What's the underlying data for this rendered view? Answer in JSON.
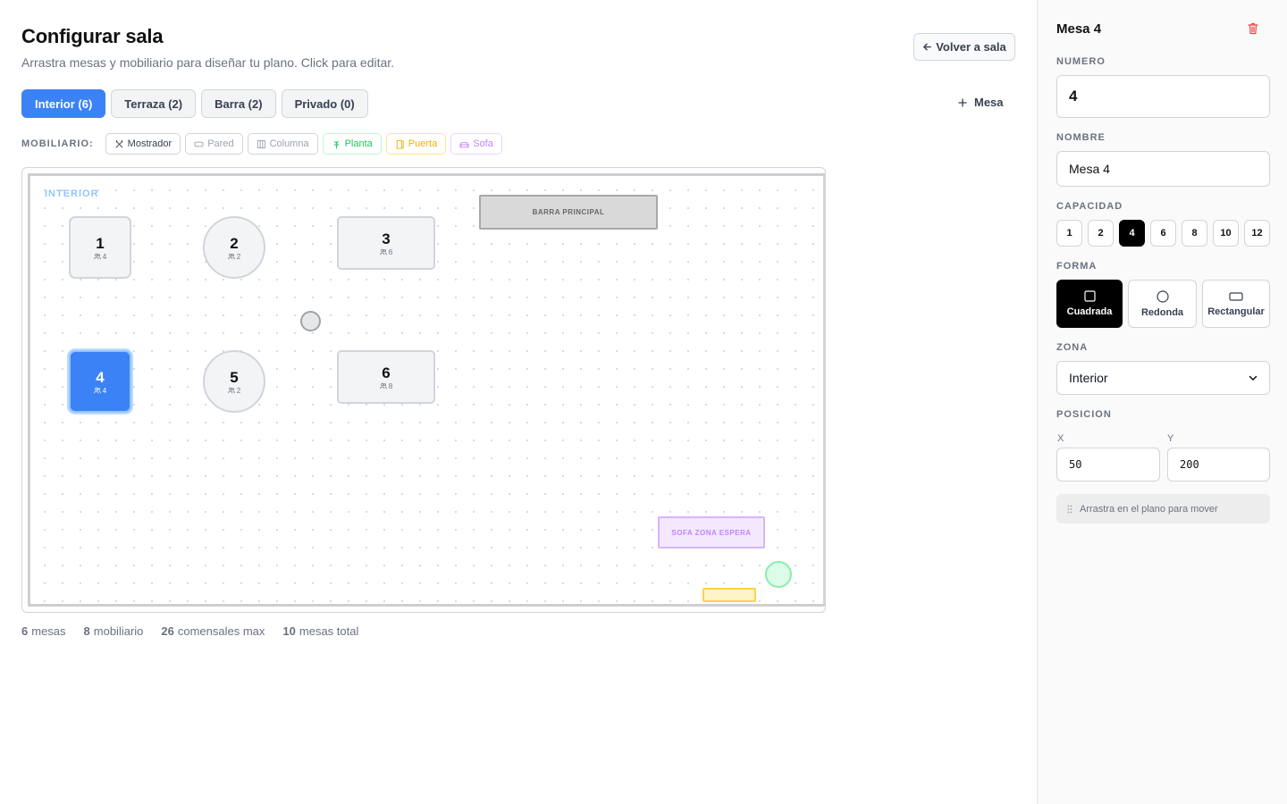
{
  "header": {
    "title": "Configurar sala",
    "subtitle": "Arrastra mesas y mobiliario para diseñar tu plano. Click para editar.",
    "back_label": "Volver a sala"
  },
  "tabs": [
    {
      "label": "Interior (6)",
      "active": true
    },
    {
      "label": "Terraza (2)",
      "active": false
    },
    {
      "label": "Barra (2)",
      "active": false
    },
    {
      "label": "Privado (0)",
      "active": false
    }
  ],
  "add_table_label": "Mesa",
  "furniture_toolbar": {
    "label": "MOBILIARIO:",
    "items": [
      {
        "label": "Mostrador",
        "icon": "utensils-icon",
        "color": "#374151"
      },
      {
        "label": "Pared",
        "icon": "wall-icon",
        "color": "#9ca3af"
      },
      {
        "label": "Columna",
        "icon": "column-icon",
        "color": "#9ca3af"
      },
      {
        "label": "Planta",
        "icon": "plant-icon",
        "color": "#22c55e"
      },
      {
        "label": "Puerta",
        "icon": "door-icon",
        "color": "#eab308"
      },
      {
        "label": "Sofa",
        "icon": "sofa-icon",
        "color": "#c084fc"
      }
    ]
  },
  "floor": {
    "zone_label": "INTERIOR",
    "tables": [
      {
        "number": "1",
        "capacity": "4",
        "shape": "square",
        "selected": false
      },
      {
        "number": "2",
        "capacity": "2",
        "shape": "round",
        "selected": false
      },
      {
        "number": "3",
        "capacity": "6",
        "shape": "rect",
        "selected": false
      },
      {
        "number": "4",
        "capacity": "4",
        "shape": "square",
        "selected": true
      },
      {
        "number": "5",
        "capacity": "2",
        "shape": "round",
        "selected": false
      },
      {
        "number": "6",
        "capacity": "8",
        "shape": "rect",
        "selected": false
      }
    ],
    "furniture": {
      "counter_label": "BARRA PRINCIPAL",
      "sofa_label": "SOFA ZONA ESPERA"
    }
  },
  "stats": [
    {
      "value": "6",
      "label": "mesas"
    },
    {
      "value": "8",
      "label": "mobiliario"
    },
    {
      "value": "26",
      "label": "comensales max"
    },
    {
      "value": "10",
      "label": "mesas total"
    }
  ],
  "panel": {
    "title": "Mesa 4",
    "number_label": "NUMERO",
    "number_value": "4",
    "name_label": "NOMBRE",
    "name_value": "Mesa 4",
    "capacity_label": "CAPACIDAD",
    "capacity_options": [
      "1",
      "2",
      "4",
      "6",
      "8",
      "10",
      "12"
    ],
    "capacity_selected": "4",
    "shape_label": "FORMA",
    "shape_options": [
      {
        "label": "Cuadrada",
        "icon": "square-shape-icon",
        "active": true
      },
      {
        "label": "Redonda",
        "icon": "circle-shape-icon",
        "active": false
      },
      {
        "label": "Rectangular",
        "icon": "rectangle-shape-icon",
        "active": false
      }
    ],
    "zone_label": "ZONA",
    "zone_value": "Interior",
    "position_label": "POSICION",
    "x_label": "X",
    "x_value": "50",
    "y_label": "Y",
    "y_value": "200",
    "drag_hint": "Arrastra en el plano para mover"
  },
  "colors": {
    "accent": "#3b82f6",
    "danger": "#ef4444",
    "selected_black": "#000000"
  }
}
